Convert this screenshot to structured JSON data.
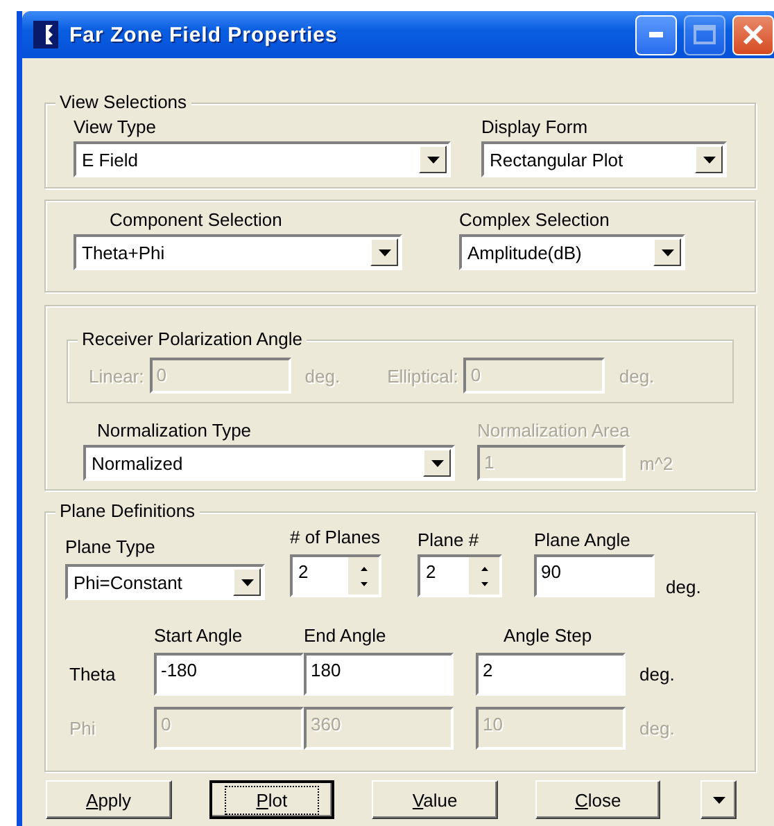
{
  "window": {
    "title": "Far Zone Field Properties",
    "maximize_disabled": true
  },
  "view_selections": {
    "title": "View Selections",
    "view_type": {
      "label": "View Type",
      "value": "E Field"
    },
    "display_form": {
      "label": "Display Form",
      "value": "Rectangular Plot"
    }
  },
  "selection": {
    "component": {
      "label": "Component Selection",
      "value": "Theta+Phi"
    },
    "complex": {
      "label": "Complex Selection",
      "value": "Amplitude(dB)"
    }
  },
  "receiver": {
    "title": "Receiver Polarization Angle",
    "disabled": true,
    "fields": [
      {
        "label": "Linear:",
        "value": "0",
        "unit": "deg."
      },
      {
        "label": "Elliptical:",
        "value": "0",
        "unit": "deg."
      }
    ]
  },
  "normalization": {
    "type": {
      "label": "Normalization Type",
      "value": "Normalized"
    },
    "area": {
      "label": "Normalization Area",
      "value": "1",
      "unit": "m^2",
      "disabled": true
    }
  },
  "planes": {
    "title": "Plane Definitions",
    "plane_type": {
      "label": "Plane Type",
      "value": "Phi=Constant"
    },
    "num_planes": {
      "label": "# of Planes",
      "value": "2"
    },
    "plane_number": {
      "label": "Plane #",
      "value": "2"
    },
    "plane_angle": {
      "label": "Plane Angle",
      "value": "90",
      "unit": "deg."
    },
    "columns": [
      "Start Angle",
      "End Angle",
      "Angle Step"
    ],
    "rows": [
      {
        "label": "Theta",
        "values": [
          "-180",
          "180",
          "2"
        ],
        "unit": "deg.",
        "disabled": false
      },
      {
        "label": "Phi",
        "values": [
          "0",
          "360",
          "10"
        ],
        "unit": "deg.",
        "disabled": true
      }
    ]
  },
  "buttons": [
    {
      "label": "Apply",
      "underline_first": true,
      "focused": false
    },
    {
      "label": "Plot",
      "underline_first": true,
      "focused": true
    },
    {
      "label": "Value",
      "underline_first": true,
      "focused": false
    },
    {
      "label": "Close",
      "underline_first": true,
      "focused": false
    }
  ]
}
